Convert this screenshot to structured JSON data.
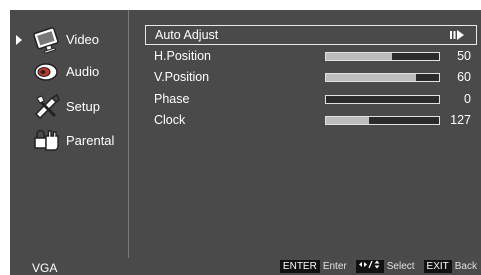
{
  "sidebar": {
    "items": [
      {
        "label": "Video",
        "icon": "monitor-icon",
        "selected": true
      },
      {
        "label": "Audio",
        "icon": "speaker-icon",
        "selected": false
      },
      {
        "label": "Setup",
        "icon": "tools-icon",
        "selected": false
      },
      {
        "label": "Parental",
        "icon": "hand-lock-icon",
        "selected": false
      }
    ]
  },
  "menu": {
    "rows": [
      {
        "label": "Auto Adjust",
        "type": "action",
        "icon": "play-action-icon"
      },
      {
        "label": "H.Position",
        "value": "50",
        "fill_fraction": 0.42
      },
      {
        "label": "V.Position",
        "value": "60",
        "fill_fraction": 0.2
      },
      {
        "label": "Phase",
        "value": "0",
        "fill_fraction": 1.0
      },
      {
        "label": "Clock",
        "value": "127",
        "fill_fraction": 0.62
      }
    ]
  },
  "status": {
    "source": "VGA",
    "enter_key": "ENTER",
    "enter_label": "Enter",
    "select_label": "Select",
    "exit_key": "EXIT",
    "exit_label": "Back"
  },
  "colors": {
    "background": "#4a4a4a",
    "bar": "#bdbdbd",
    "bar_fill": "#2b2b2b"
  }
}
